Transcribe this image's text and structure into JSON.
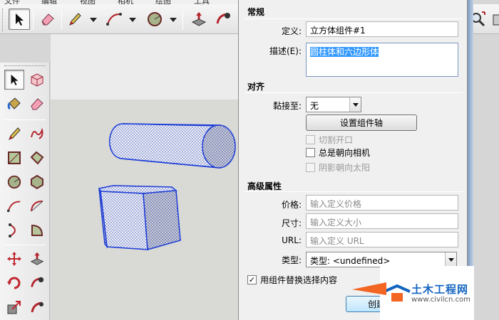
{
  "menubar": {
    "items": [
      "文件",
      "编辑",
      "视图",
      "相机",
      "绘图",
      "工具"
    ]
  },
  "dialog": {
    "general": {
      "title": "常规",
      "definition_label": "定义:",
      "definition_value": "立方体组件#1",
      "description_label": "描述(E):",
      "description_value": "圆柱体和六边形体"
    },
    "alignment": {
      "title": "对齐",
      "glue_label": "黏接至:",
      "glue_value": "无",
      "set_axes_button": "设置组件轴",
      "cut_opening": "切割开口",
      "always_face_camera": "总是朝向相机",
      "shadows_face_sun": "阴影朝向太阳"
    },
    "advanced": {
      "title": "高级属性",
      "price_label": "价格:",
      "price_placeholder": "输入定义价格",
      "size_label": "尺寸:",
      "size_placeholder": "输入定义大小",
      "url_label": "URL:",
      "url_placeholder": "输入定义 URL",
      "type_label": "类型:",
      "type_value": "类型: <undefined>"
    },
    "replace_selection": "用组件替换选择内容",
    "create_button": "创建"
  },
  "watermark": {
    "main": "土木工程网",
    "sub": "www.civilcn.com"
  },
  "colors": {
    "selection_edge": "#1a3bd6",
    "watermark_blue": "#1565c0",
    "watermark_orange": "#f26522"
  }
}
